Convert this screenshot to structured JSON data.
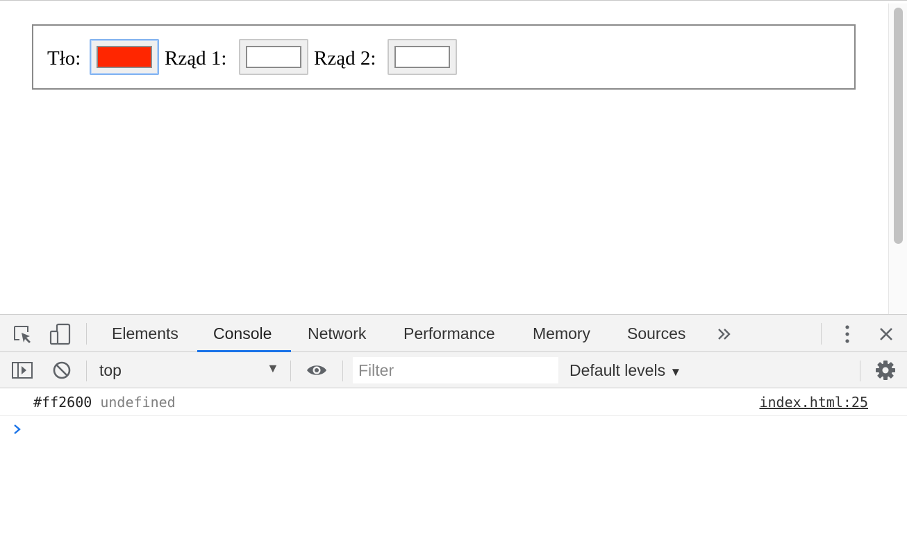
{
  "page": {
    "background_label": "Tło:",
    "row1_label": "Rząd 1:",
    "row2_label": "Rząd 2:",
    "background_color": "#ff2600",
    "row1_color": "#ffffff",
    "row2_color": "#ffffff"
  },
  "devtools": {
    "tabs": [
      "Elements",
      "Console",
      "Network",
      "Performance",
      "Memory",
      "Sources"
    ],
    "active_tab": "Console",
    "more_tabs_icon": "chevron-double-right-icon",
    "icons": {
      "inspect": "inspect-element-icon",
      "device": "device-toolbar-icon",
      "menu": "kebab-menu-icon",
      "close": "close-icon",
      "sidebar": "console-sidebar-icon",
      "clear": "clear-console-icon",
      "eye": "live-expression-icon",
      "settings": "gear-icon"
    },
    "toolbar": {
      "context": "top",
      "filter_placeholder": "Filter",
      "levels": "Default levels"
    },
    "console": {
      "messages": [
        {
          "text": "#ff2600",
          "extra": "undefined",
          "source": "index.html:25"
        }
      ]
    },
    "accent_color": "#1a73e8"
  }
}
